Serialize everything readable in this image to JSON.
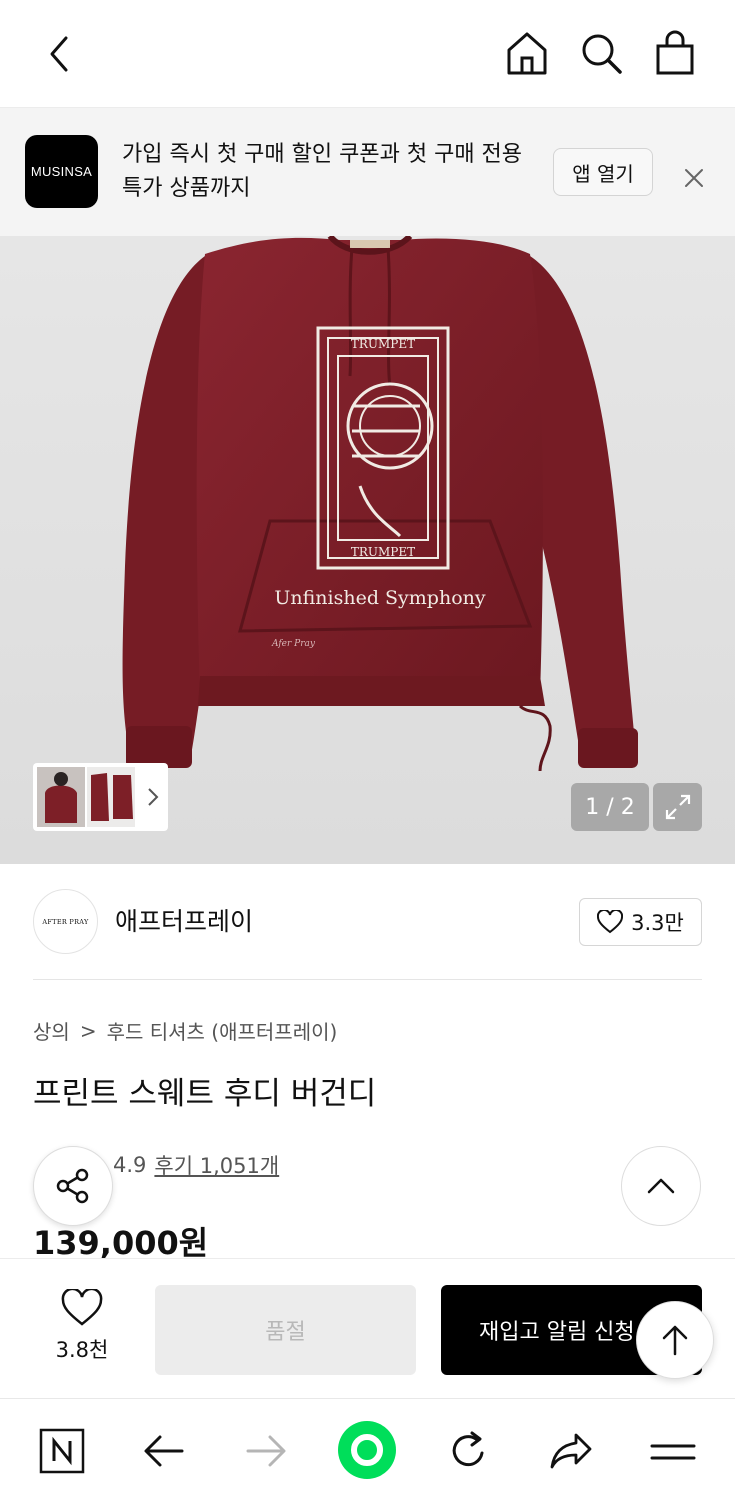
{
  "topbar": {
    "back": "back-icon",
    "home": "home-icon",
    "search": "search-icon",
    "cart": "shopping-bag-icon"
  },
  "banner": {
    "logo_text": "MUSINSA",
    "text": "가입 즉시 첫 구매 할인 쿠폰과 첫 구매 전용 특가 상품까지",
    "open_app_label": "앱 열기"
  },
  "gallery": {
    "counter": "1 / 2",
    "print_title": "Unfinished Symphony",
    "print_word": "TRUMPET",
    "print_sign": "Afer Pray"
  },
  "brand": {
    "logo_text": "AFTER PRAY",
    "name": "애프터프레이",
    "likes": "3.3만"
  },
  "product": {
    "breadcrumb": {
      "category": "상의",
      "separator": ">",
      "subcategory": "후드 티셔츠 (애프터프레이)"
    },
    "title": "프린트 스웨트 후디 버건디",
    "rating": "4.9",
    "reviews": "후기 1,051개",
    "price": "139,000원"
  },
  "action_bar": {
    "wish_count": "3.8천",
    "soldout_label": "품절",
    "restock_label": "재입고 알림 신청"
  },
  "browser_nav": [
    "naver-n-icon",
    "back-arrow-icon",
    "forward-arrow-icon",
    "green-dot-home-icon",
    "refresh-icon",
    "share-arrow-icon",
    "menu-icon"
  ],
  "colors": {
    "hoodie": "#7d1f27",
    "accent_green": "#00de5a",
    "button_black": "#000000",
    "soldout_gray": "#ececec"
  }
}
